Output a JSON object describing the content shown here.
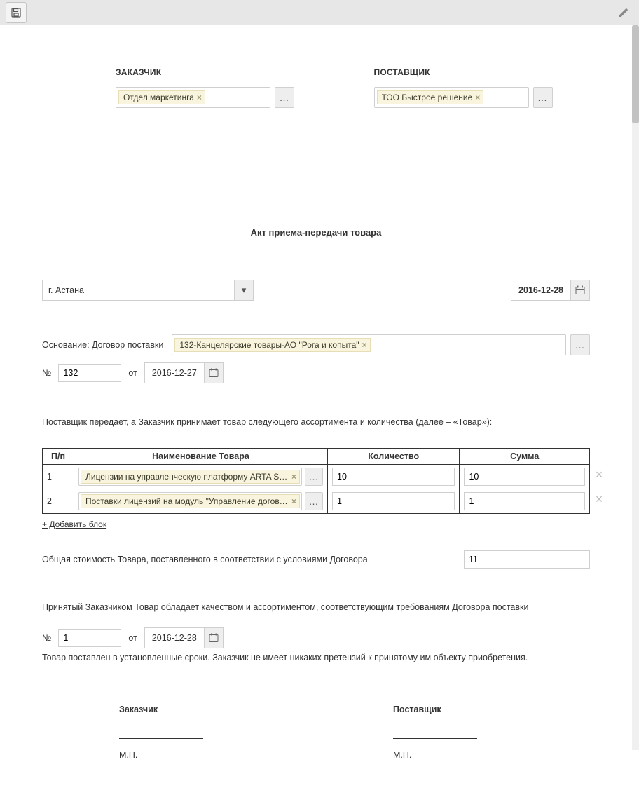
{
  "toolbar": {},
  "parties": {
    "customer_label": "ЗАКАЗЧИК",
    "supplier_label": "ПОСТАВЩИК",
    "customer_value": "Отдел маркетинга",
    "supplier_value": "ТОО Быстрое решение"
  },
  "title": "Акт приема-передачи товара",
  "city": "г. Астана",
  "doc_date": "2016-12-28",
  "basis": {
    "label": "Основание: Договор поставки",
    "value": "132-Канцелярские товары-АО \"Рога и копыта\"",
    "num_label": "№",
    "num": "132",
    "from_label": "от",
    "date": "2016-12-27"
  },
  "intro": "Поставщик передает, а Заказчик принимает товар следующего ассортимента и количества (далее – «Товар»):",
  "table": {
    "headers": {
      "pp": "П/п",
      "name": "Наименование Товара",
      "qty": "Количество",
      "sum": "Сумма"
    },
    "rows": [
      {
        "pp": "1",
        "name": "Лицензии на управленческую платформу ARTA Syne…",
        "qty": "10",
        "sum": "10"
      },
      {
        "pp": "2",
        "name": "Поставки лицензий на модуль \"Управление договор…",
        "qty": "1",
        "sum": "1"
      }
    ],
    "add_label": "+ Добавить блок"
  },
  "total": {
    "label": "Общая стоимость Товара, поставленного в соответствии с условиями Договора",
    "value": "11"
  },
  "quality": {
    "text": "Принятый Заказчиком Товар обладает качеством и ассортиментом, соответствующим требованиям Договора поставки",
    "num_label": "№",
    "num": "1",
    "from_label": "от",
    "date": "2016-12-28"
  },
  "footer_text": "Товар поставлен в установленные сроки. Заказчик не имеет никаких претензий к принятому им объекту приобретения.",
  "signatures": {
    "customer": "Заказчик",
    "supplier": "Поставщик",
    "mp": "М.П."
  }
}
